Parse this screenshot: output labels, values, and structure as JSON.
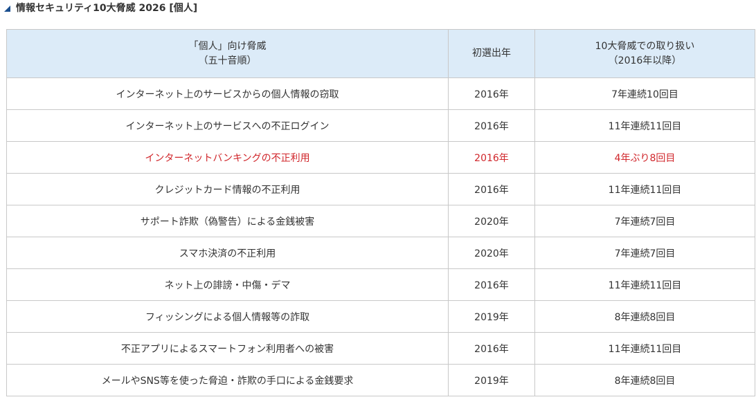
{
  "page": {
    "title": "情報セキュリティ10大脅威 2026 [個人]"
  },
  "table": {
    "headers": {
      "threat_line1": "「個人」向け脅威",
      "threat_line2": "（五十音順）",
      "first_year": "初選出年",
      "history_line1": "10大脅威での取り扱い",
      "history_line2": "（2016年以降）"
    },
    "rows": [
      {
        "threat": "インターネット上のサービスからの個人情報の窃取",
        "first_year": "2016年",
        "history": "7年連続10回目",
        "highlight": false
      },
      {
        "threat": "インターネット上のサービスへの不正ログイン",
        "first_year": "2016年",
        "history": "11年連続11回目",
        "highlight": false
      },
      {
        "threat": "インターネットバンキングの不正利用",
        "first_year": "2016年",
        "history": "4年ぶり8回目",
        "highlight": true
      },
      {
        "threat": "クレジットカード情報の不正利用",
        "first_year": "2016年",
        "history": "11年連続11回目",
        "highlight": false
      },
      {
        "threat": "サポート詐欺（偽警告）による金銭被害",
        "first_year": "2020年",
        "history": "7年連続7回目",
        "highlight": false
      },
      {
        "threat": "スマホ決済の不正利用",
        "first_year": "2020年",
        "history": "7年連続7回目",
        "highlight": false
      },
      {
        "threat": "ネット上の誹謗・中傷・デマ",
        "first_year": "2016年",
        "history": "11年連続11回目",
        "highlight": false
      },
      {
        "threat": "フィッシングによる個人情報等の詐取",
        "first_year": "2019年",
        "history": "8年連続8回目",
        "highlight": false
      },
      {
        "threat": "不正アプリによるスマートフォン利用者への被害",
        "first_year": "2016年",
        "history": "11年連続11回目",
        "highlight": false
      },
      {
        "threat": "メールやSNS等を使った脅迫・詐欺の手口による金銭要求",
        "first_year": "2019年",
        "history": "8年連続8回目",
        "highlight": false
      }
    ],
    "colors": {
      "header_bg": "#dcebf8",
      "highlight_text": "#d0252a",
      "border": "#c8c8c8"
    }
  }
}
